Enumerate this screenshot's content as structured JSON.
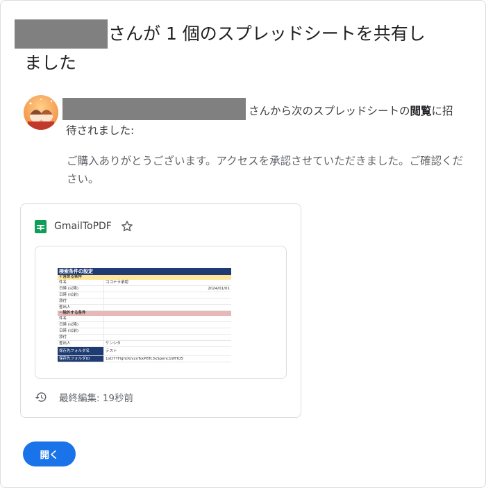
{
  "email": {
    "heading_line1": "さんが 1 個のスプレッドシートを共有し",
    "heading_line2": "ました",
    "invite_text": "さんから次のスプレッドシートの",
    "invite_bold": "閲覧",
    "invite_text2": "に招",
    "invite_line2": "待されました:",
    "message": "ご購入ありがとうございます。アクセスを承認させていただきました。ご確認ください。"
  },
  "card": {
    "file_name": "GmailToPDF",
    "last_edited": "最終編集: 19秒前"
  },
  "sheet_preview": {
    "title": "検索条件の設定",
    "section1": "＋含める条件",
    "rows1": [
      {
        "key": "件名",
        "value": "ココナラ承認",
        "extra": ""
      },
      {
        "key": "日時 (以降)",
        "value": "",
        "extra": "2024/01/01"
      },
      {
        "key": "日時 (以前)",
        "value": "",
        "extra": ""
      },
      {
        "key": "添付",
        "value": "",
        "extra": ""
      },
      {
        "key": "差出人",
        "value": "",
        "extra": ""
      }
    ],
    "section2": "－除外する条件",
    "rows2": [
      {
        "key": "件名",
        "value": ""
      },
      {
        "key": "日時 (以降)",
        "value": ""
      },
      {
        "key": "日時 (以前)",
        "value": ""
      },
      {
        "key": "添付",
        "value": ""
      },
      {
        "key": "差出人",
        "value": "ケンシタ"
      }
    ],
    "folder_label": "保存先フォルダ名",
    "folder_value": "テスト",
    "folder_id_label": "保存先フォルダID",
    "folder_id_value": "1xD7YHghDUvzxTsxP8Tc3xSpenc1WHQ5"
  },
  "actions": {
    "open_label": "開く"
  },
  "colors": {
    "accent": "#1a73e8",
    "sheets_green": "#0f9d58",
    "sheet_header": "#1f3b73"
  }
}
